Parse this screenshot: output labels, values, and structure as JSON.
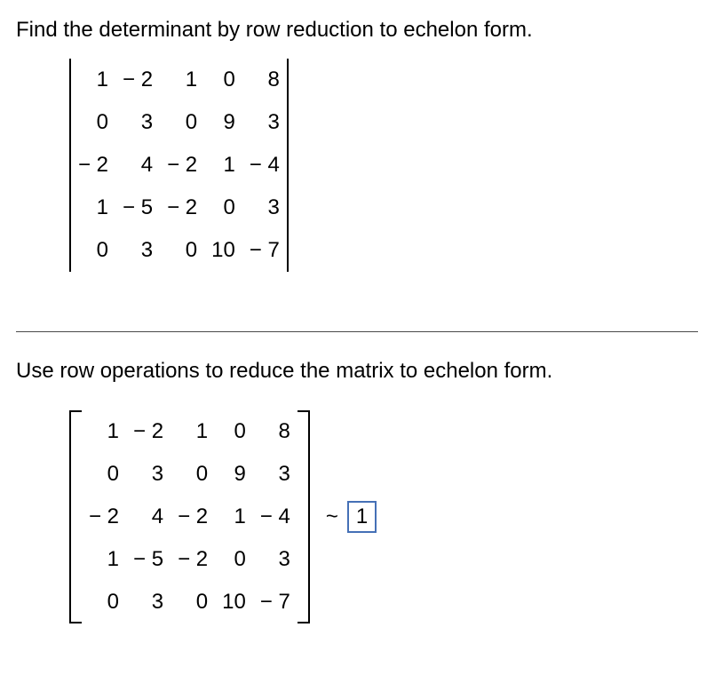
{
  "instruction1": "Find the determinant by row reduction to echelon form.",
  "instruction2": "Use row operations to reduce the matrix to echelon form.",
  "matrix1": {
    "r0": {
      "c0": "1",
      "c1": "− 2",
      "c2": "1",
      "c3": "0",
      "c4": "8"
    },
    "r1": {
      "c0": "0",
      "c1": "3",
      "c2": "0",
      "c3": "9",
      "c4": "3"
    },
    "r2": {
      "c0": "− 2",
      "c1": "4",
      "c2": "− 2",
      "c3": "1",
      "c4": "− 4"
    },
    "r3": {
      "c0": "1",
      "c1": "− 5",
      "c2": "− 2",
      "c3": "0",
      "c4": "3"
    },
    "r4": {
      "c0": "0",
      "c1": "3",
      "c2": "0",
      "c3": "10",
      "c4": "− 7"
    }
  },
  "matrix2": {
    "r0": {
      "c0": "1",
      "c1": "− 2",
      "c2": "1",
      "c3": "0",
      "c4": "8"
    },
    "r1": {
      "c0": "0",
      "c1": "3",
      "c2": "0",
      "c3": "9",
      "c4": "3"
    },
    "r2": {
      "c0": "− 2",
      "c1": "4",
      "c2": "− 2",
      "c3": "1",
      "c4": "− 4"
    },
    "r3": {
      "c0": "1",
      "c1": "− 5",
      "c2": "− 2",
      "c3": "0",
      "c4": "3"
    },
    "r4": {
      "c0": "0",
      "c1": "3",
      "c2": "0",
      "c3": "10",
      "c4": "− 7"
    }
  },
  "tilde": "~",
  "answer_value": "1"
}
